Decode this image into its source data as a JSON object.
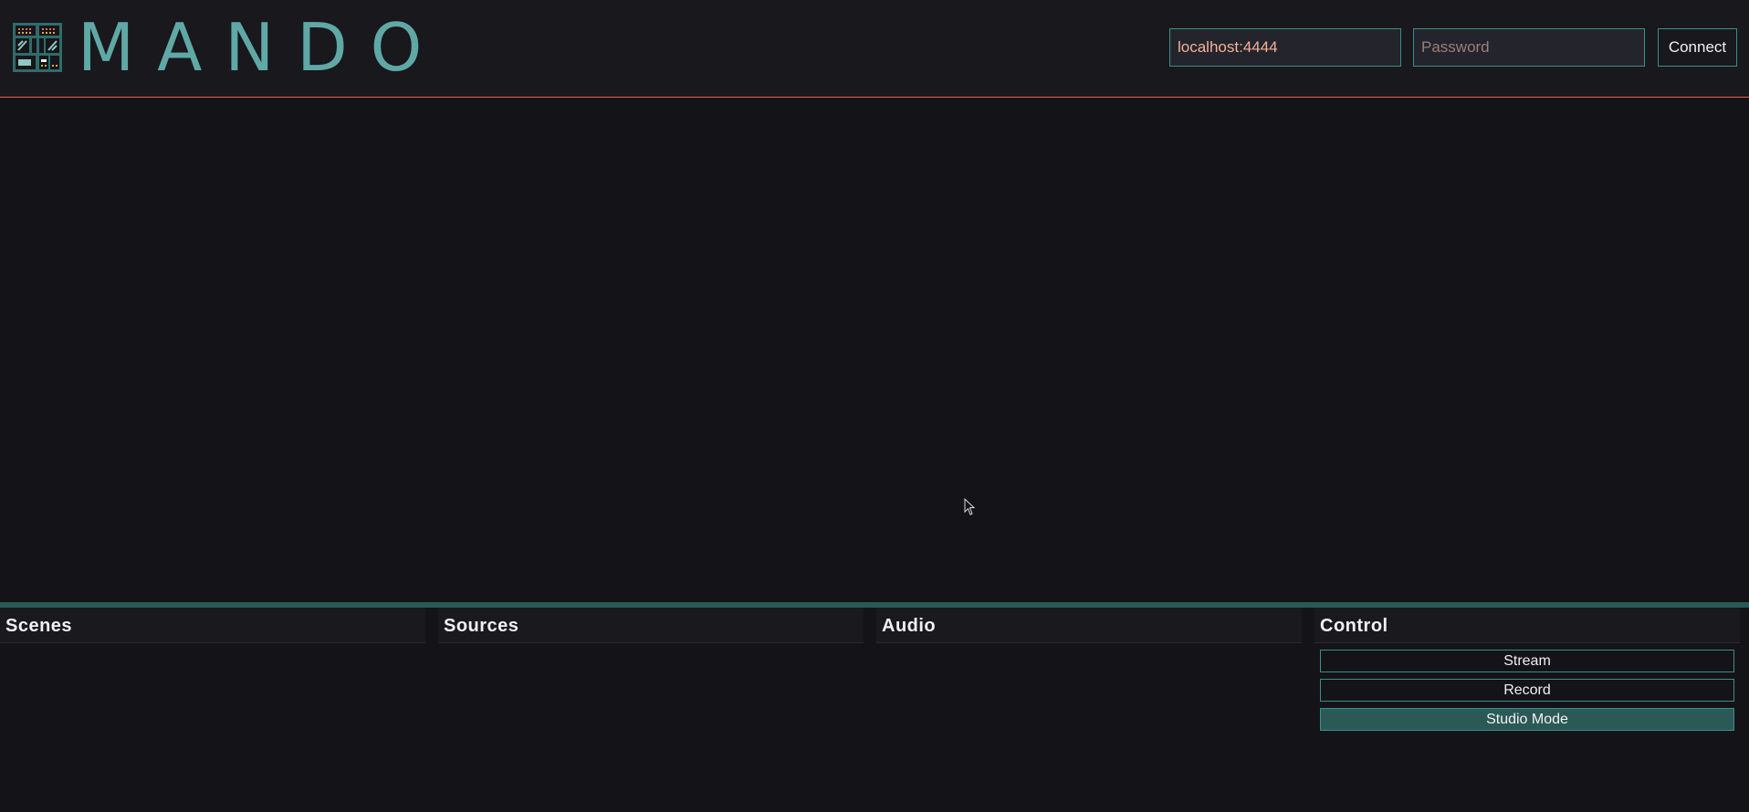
{
  "header": {
    "logo_text": "MANDO",
    "host": {
      "value": "localhost:4444",
      "placeholder": ""
    },
    "password": {
      "value": "",
      "placeholder": "Password"
    },
    "connect_label": "Connect"
  },
  "panels": {
    "scenes": {
      "title": "Scenes"
    },
    "sources": {
      "title": "Sources"
    },
    "audio": {
      "title": "Audio"
    },
    "control": {
      "title": "Control",
      "buttons": [
        {
          "label": "Stream",
          "active": false
        },
        {
          "label": "Record",
          "active": false
        },
        {
          "label": "Studio Mode",
          "active": true
        }
      ]
    }
  },
  "colors": {
    "accent": "#5fa8a6",
    "border": "#3d8d8a",
    "header_rule": "#e0684a",
    "active_button": "#2b5a56",
    "background": "#131318"
  }
}
